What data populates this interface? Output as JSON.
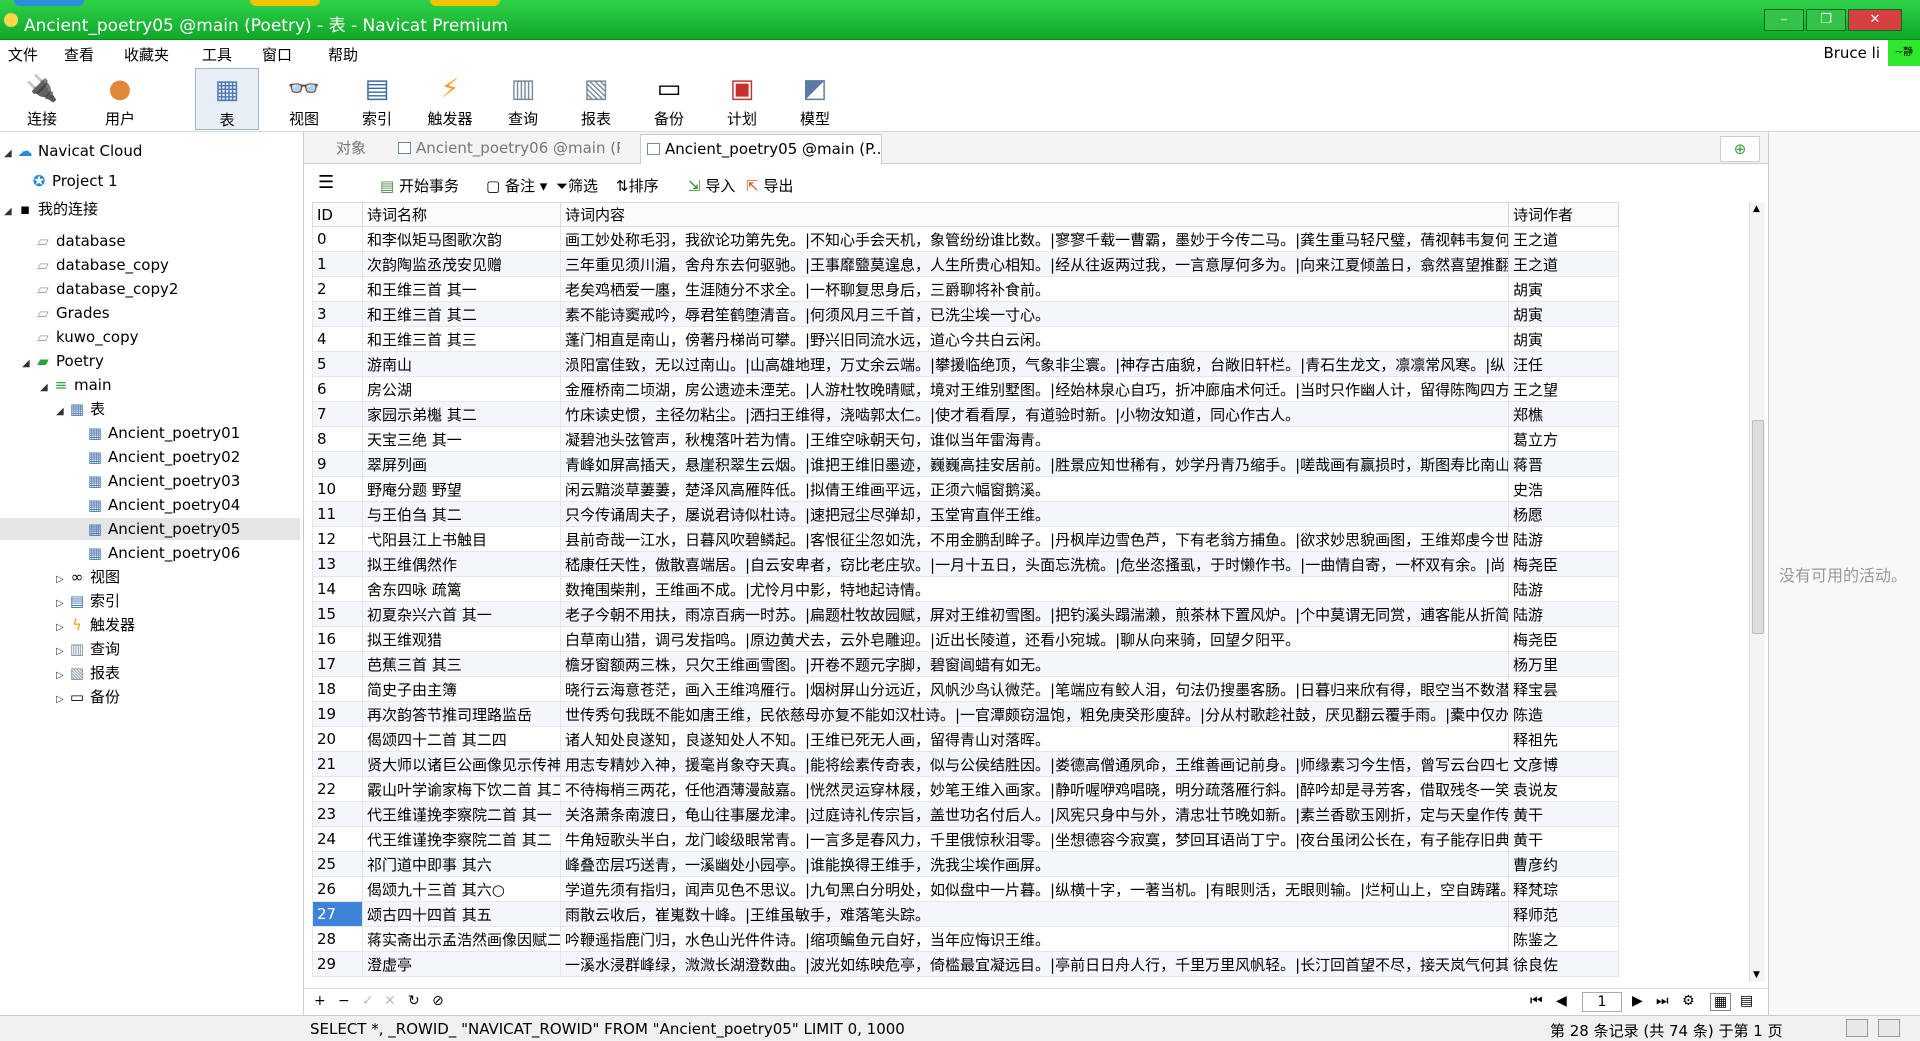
{
  "window": {
    "title": "Ancient_poetry05 @main (Poetry) - 表 - Navicat Premium",
    "min": "–",
    "max": "❐",
    "close": "✕"
  },
  "menu": [
    "文件",
    "查看",
    "收藏夹",
    "工具",
    "窗口",
    "帮助"
  ],
  "user": {
    "name": "Bruce li",
    "badge": "~静"
  },
  "toolbar": [
    "连接",
    "用户",
    "表",
    "视图",
    "索引",
    "触发器",
    "查询",
    "报表",
    "备份",
    "计划",
    "模型"
  ],
  "sidebar": {
    "cloud": "Navicat Cloud",
    "project": "Project 1",
    "myconn": "我的连接",
    "dbs": [
      "database",
      "database_copy",
      "database_copy2",
      "Grades",
      "kuwo_copy"
    ],
    "poetry": "Poetry",
    "main": "main",
    "tables_label": "表",
    "tables": [
      "Ancient_poetry01",
      "Ancient_poetry02",
      "Ancient_poetry03",
      "Ancient_poetry04",
      "Ancient_poetry05",
      "Ancient_poetry06"
    ],
    "others": [
      "视图",
      "索引",
      "触发器",
      "查询",
      "报表",
      "备份"
    ]
  },
  "tabs": {
    "objects": "对象",
    "tab1": "Ancient_poetry06 @main (P...",
    "tab2": "Ancient_poetry05 @main (P..."
  },
  "objtools": {
    "begin": "开始事务",
    "memo": "备注",
    "filter": "筛选",
    "sort": "排序",
    "import": "导入",
    "export": "导出"
  },
  "grid": {
    "columns": [
      "ID",
      "诗词名称",
      "诗词内容",
      "诗词作者"
    ],
    "rows": [
      [
        "0",
        "和李似矩马图歌次韵",
        "画工妙处称毛羽，我欲论功第先免。|不知心手会天机，象管纷纷谁比数。|寥寥千载一曹霸，墨妙于今传二马。|龚生重马轻尺璧，蒨视韩韦复何",
        "王之道"
      ],
      [
        "1",
        "次韵陶监丞茂安见赠",
        "三年重见须川湄，舍舟东去何驱驰。|王事靡盬莫遑息，人生所贵心相知。|经从往返两过我，一言意厚何多为。|向来江夏倾盖日，翕然喜望推翻",
        "王之道"
      ],
      [
        "2",
        "和王维三首 其一",
        "老矣鸡栖爱一廛，生涯随分不求全。|一杯聊复思身后，三爵聊将补食前。",
        "胡寅"
      ],
      [
        "3",
        "和王维三首 其二",
        "素不能诗窦戒吟，辱君笙鹤堕清音。|何须风月三千首，已洗尘埃一寸心。",
        "胡寅"
      ],
      [
        "4",
        "和王维三首 其三",
        "蓬门相直是南山，傍著丹梯尚可攀。|野兴旧同流水远，道心今共白云闲。",
        "胡寅"
      ],
      [
        "5",
        "游南山",
        "涢阳富佳致，无以过南山。|山高雄地理，万丈余云端。|攀援临绝顶，气象非尘寰。|神存古庙貌，台敞旧轩栏。|青石生龙文，凛凛常风寒。|纵",
        "汪任"
      ],
      [
        "6",
        "房公湖",
        "金雁桥南二顷湖，房公遗迹未湮芜。|人游杜牧晚晴赋，境对王维别墅图。|经始林泉心自巧，折冲廊庙术何迁。|当时只作幽人计，留得陈陶四方",
        "王之望"
      ],
      [
        "7",
        "家园示弟櫆 其二",
        "竹床读史惯，主径勿粘尘。|洒扫王维得，浇啮郭太仁。|使才看看厚，有道验时新。|小物汝知道，同心作古人。",
        "郑樵"
      ],
      [
        "8",
        "天宝三绝 其一",
        "凝碧池头弦管声，秋槐落叶若为情。|王维空咏朝天句，谁似当年雷海青。",
        "葛立方"
      ],
      [
        "9",
        "翠屏列画",
        "青峰如屏高插天，悬崖积翠生云烟。|谁把王维旧墨迹，巍巍高挂安居前。|胜景应知世稀有，妙学丹青乃缩手。|嗟哉画有赢损时，斯图寿比南山",
        "蒋晋"
      ],
      [
        "10",
        "野庵分题 野望",
        "闲云黯淡草萋萋，楚泽风高雁阵低。|拟倩王维画平远，正须六幅窗鹅溪。",
        "史浩"
      ],
      [
        "11",
        "与王伯刍 其二",
        "只今传诵周夫子，屡说君诗似杜诗。|速把冠尘尽弹却，玉堂宵直伴王维。",
        "杨愿"
      ],
      [
        "12",
        "弋阳县江上书触目",
        "县前奇哉一江水，日暮风吹碧鳞起。|客恨征尘忽如洗，不用金鹏刮眸子。|丹枫岸边雪色芦，下有老翁方捕鱼。|欲求妙思貌画图，王维郑虔今世",
        "陆游"
      ],
      [
        "13",
        "拟王维偶然作",
        "嵇康任天性，傲散喜端居。|自云安卑者，窃比老庄欤。|一月十五日，头面忘洗梳。|危坐恣搔虱，于时懒作书。|一曲情自寄，一杯双有余。|尚",
        "梅尧臣"
      ],
      [
        "14",
        "舍东四咏 疏篱",
        "数掩围柴荆，王维画不成。|尤怜月中影，特地起诗情。",
        "陆游"
      ],
      [
        "15",
        "初夏杂兴六首 其一",
        "老子今朝不用扶，雨凉百病一时苏。|扁题杜牧故园赋，屏对王维初雪图。|把钓溪头蹋湍濑，煎茶林下置风炉。|个中莫谓无同赏，逋客能从折简",
        "陆游"
      ],
      [
        "16",
        "拟王维观猎",
        "白草南山猎，调弓发指鸣。|原边黄犬去，云外皂雕迎。|近出长陵道，还看小宛城。|聊从向来骑，回望夕阳平。",
        "梅尧臣"
      ],
      [
        "17",
        "芭蕉三首 其三",
        "檐牙窗额两三株，只欠王维画雪图。|开卷不题元字脚，碧窗阊蜡有如无。",
        "杨万里"
      ],
      [
        "18",
        "简史子由主簿",
        "晓行云海意苍茫，画入王维鸿雁行。|烟树屏山分远近，风帆沙鸟认微茫。|笔端应有鲛人泪，句法仍搜墨客肠。|日暮归来欣有得，眼空当不数潜",
        "释宝昙"
      ],
      [
        "19",
        "再次韵答节推司理路监岳",
        "世传秀句我既不能如唐王维，民依慈母亦复不能如汉杜诗。|一官潭颇窃温饱，粗免庚癸形廋辞。|分从村歌趁社鼓，厌见翻云覆手雨。|橐中仅办",
        "陈造"
      ],
      [
        "20",
        "偈颂四十二首 其二四",
        "诸人知处良遂知，良遂知处人不知。|王维已死无人画，留得青山对落晖。",
        "释祖先"
      ],
      [
        "21",
        "贤大师以诸巨公画像见示传神",
        "用志专精妙入神，援毫肖象夺天真。|能将绘素传奇表，似与公侯结胜因。|娄德高僧通夙命，王维善画记前身。|师缘素习今生悟，曾写云台四七",
        "文彦博"
      ],
      [
        "22",
        "霰山叶学谕家梅下饮二首 其二",
        "不待梅梢三两花，任他酒薄漫敲嘉。|恍然灵运穿林屐，妙笔王维入画家。|静听喔咿鸡唱晓，明分疏落雁行斜。|醉吟却是寻芳客，借取残冬一笑",
        "袁说友"
      ],
      [
        "23",
        "代王维谨挽李察院二首 其一",
        "关洛萧条南渡日，龟山往事屡龙津。|过庭诗礼传宗旨，盖世功名付后人。|风宪只身中与外，清忠壮节晚如新。|素兰香歇玉刚折，定与天皇作传",
        "黄干"
      ],
      [
        "24",
        "代王维谨挽李察院二首 其二",
        "牛角短歌头半白，龙门峻级眼常青。|一言多是春风力，千里俄惊秋泪零。|坐想德容今寂寞，梦回耳语尚丁宁。|夜台虽闭公长在，有子能存旧典",
        "黄干"
      ],
      [
        "25",
        "祁门道中即事 其六",
        "峰叠峦层巧送青，一溪幽处小园亭。|谁能换得王维手，洗我尘埃作画屏。",
        "曹彦约"
      ],
      [
        "26",
        "偈颂九十三首 其六○",
        "学道先须有指归，闻声见色不思议。|九旬黑白分明处，如似盘中一片暮。|纵横十字，一著当机。|有眼则活，无眼则输。|烂柯山上，空自踌躇。",
        "释梵琮"
      ],
      [
        "27",
        "颂古四十四首 其五",
        "雨散云收后，崔嵬数十峰。|王维虽敏手，难落笔头踪。",
        "释师范"
      ],
      [
        "28",
        "蒋实斋出示孟浩然画像因赋二",
        "吟鞭遥指鹿门归，水色山光件件诗。|缩项鳊鱼元自好，当年应悔识王维。",
        "陈鉴之"
      ],
      [
        "29",
        "澄虚亭",
        "一溪水浸群峰绿，溦溦长湖澄数曲。|波光如练映危亭，倚槛最宜凝远目。|亭前日日舟人行，千里万里风帆轻。|长汀回首望不尽，接天岚气何其",
        "徐良佐"
      ]
    ],
    "current_row": "27"
  },
  "nav": {
    "page": "1"
  },
  "status": {
    "sql": "SELECT *, _ROWID_ \"NAVICAT_ROWID\" FROM \"Ancient_poetry05\" LIMIT 0, 1000",
    "records": "第 28 条记录 (共 74 条) 于第 1 页"
  },
  "right_panel": {
    "no_activity": "没有可用的活动。"
  }
}
